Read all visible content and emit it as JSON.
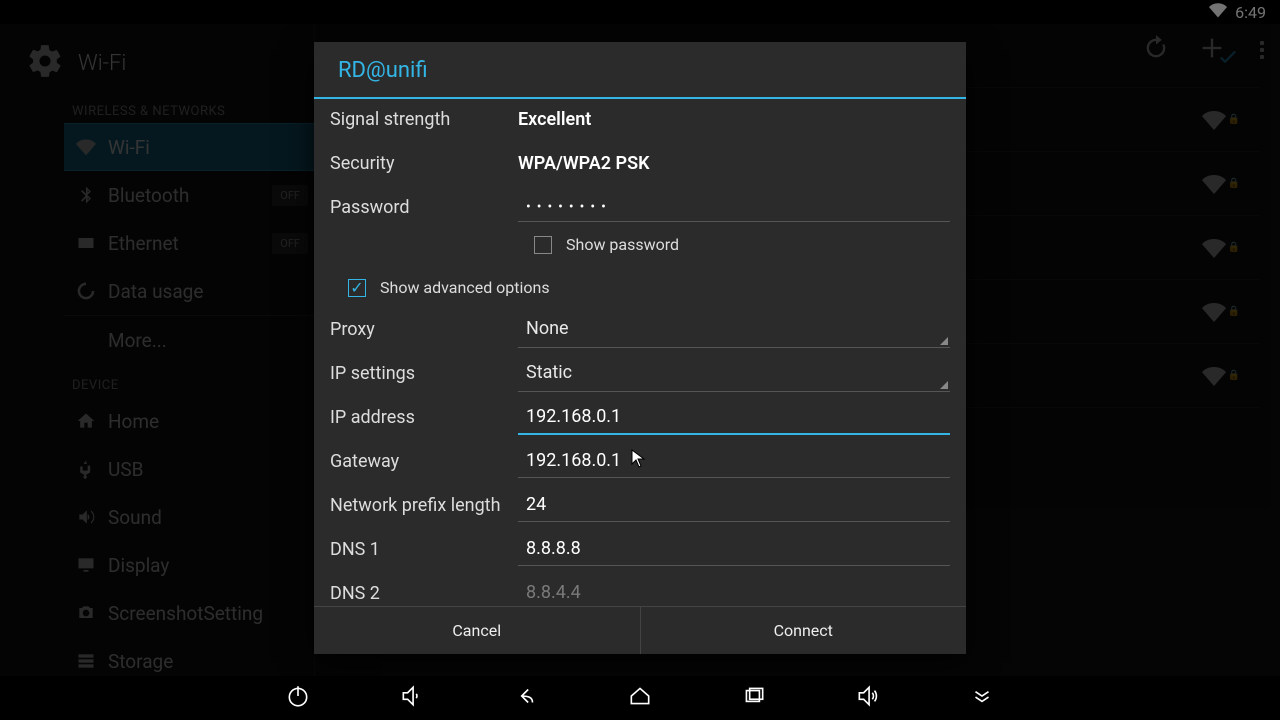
{
  "statusbar": {
    "time": "6:49"
  },
  "settings": {
    "title": "Wi-Fi",
    "cat_wireless": "WIRELESS & NETWORKS",
    "cat_device": "DEVICE",
    "items": {
      "wifi": "Wi-Fi",
      "bluetooth": "Bluetooth",
      "ethernet": "Ethernet",
      "data_usage": "Data usage",
      "more": "More...",
      "home": "Home",
      "usb": "USB",
      "sound": "Sound",
      "display": "Display",
      "screenshot": "ScreenshotSetting",
      "storage": "Storage"
    },
    "toggle_off": "OFF"
  },
  "dialog": {
    "title": "RD@unifi",
    "signal_label": "Signal strength",
    "signal_value": "Excellent",
    "security_label": "Security",
    "security_value": "WPA/WPA2 PSK",
    "password_label": "Password",
    "password_value": "••••••••",
    "show_password": "Show password",
    "show_advanced": "Show advanced options",
    "proxy_label": "Proxy",
    "proxy_value": "None",
    "ipsettings_label": "IP settings",
    "ipsettings_value": "Static",
    "ip_label": "IP address",
    "ip_value": "192.168.0.1",
    "gateway_label": "Gateway",
    "gateway_value": "192.168.0.1",
    "prefix_label": "Network prefix length",
    "prefix_value": "24",
    "dns1_label": "DNS 1",
    "dns1_value": "8.8.8.8",
    "dns2_label": "DNS 2",
    "dns2_placeholder": "8.8.4.4",
    "cancel": "Cancel",
    "connect": "Connect"
  }
}
